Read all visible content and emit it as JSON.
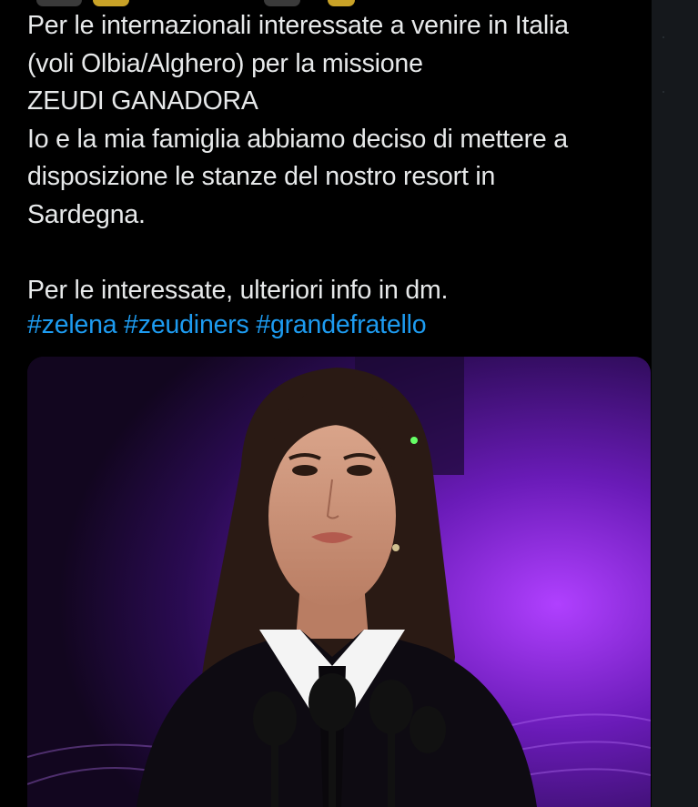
{
  "tweet": {
    "lines": [
      "Per le internazionali interessate a venire in Italia",
      "(voli Olbia/Alghero) per la missione",
      "ZEUDI GANADORA",
      "Io e  la mia famiglia abbiamo deciso di mettere a",
      "disposizione le stanze del nostro resort in",
      "Sardegna.",
      "",
      "Per le interessate, ulteriori info in dm."
    ],
    "hashtags": [
      "#zelena",
      "#zeudiners",
      "#grandefratello"
    ]
  },
  "media": {
    "subject": "woman-at-podium-photo",
    "background_color": "#3a0f6e",
    "accent_color": "#8a2be2"
  },
  "colors": {
    "background": "#000000",
    "text": "#e7e9ea",
    "link": "#1d9bf0"
  }
}
